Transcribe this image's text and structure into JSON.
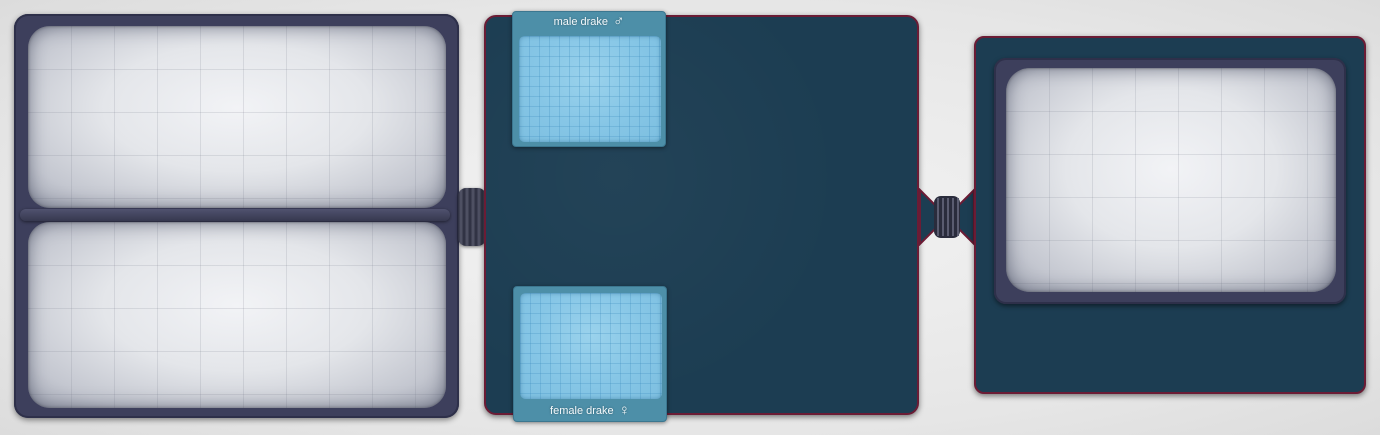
{
  "slots": {
    "male": {
      "label": "male drake",
      "symbol": "♂"
    },
    "female": {
      "label": "female drake",
      "symbol": "♀"
    }
  },
  "colors": {
    "background": "#e6e6e6",
    "frame": "#3d3f5c",
    "board": "#1c3d52",
    "board_border": "#6b1c35",
    "slot": "#4d8fa8",
    "slot_inner": "#86c6e6"
  }
}
